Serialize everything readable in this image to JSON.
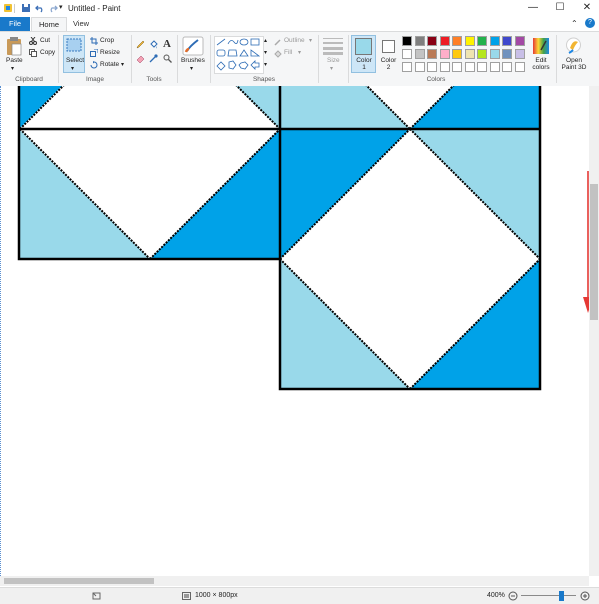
{
  "window": {
    "title": "Untitled - Paint"
  },
  "tabs": {
    "file": "File",
    "home": "Home",
    "view": "View"
  },
  "clipboard": {
    "paste": "Paste",
    "cut": "Cut",
    "copy": "Copy",
    "group": "Clipboard"
  },
  "image": {
    "select": "Select",
    "crop": "Crop",
    "resize": "Resize",
    "rotate": "Rotate",
    "group": "Image"
  },
  "tools": {
    "group": "Tools"
  },
  "brushes": {
    "label": "Brushes"
  },
  "shapes": {
    "outline": "Outline",
    "fill": "Fill",
    "group": "Shapes"
  },
  "size": {
    "label": "Size"
  },
  "color1": {
    "label": "Color 1",
    "color": "#99d9ea"
  },
  "color2": {
    "label": "Color 2",
    "color": "#ffffff"
  },
  "colors": {
    "group": "Colors",
    "palette_row1": [
      "#000000",
      "#7f7f7f",
      "#880015",
      "#ed1c24",
      "#ff7f27",
      "#fff200",
      "#22b14c",
      "#00a2e8",
      "#3f48cc",
      "#a349a4"
    ],
    "palette_row2": [
      "#ffffff",
      "#c3c3c3",
      "#b97a57",
      "#ffaec9",
      "#ffc90e",
      "#efe4b0",
      "#b5e61d",
      "#99d9ea",
      "#7092be",
      "#c8bfe7"
    ]
  },
  "edit_colors": {
    "label": "Edit colors"
  },
  "paint3d": {
    "label": "Open Paint 3D"
  },
  "canvas": {
    "light_blue": "#99d9ea",
    "blue": "#00a2e8"
  },
  "status": {
    "dimensions": "1000 × 800px",
    "zoom": "400%",
    "zoom_level": 0.72
  }
}
